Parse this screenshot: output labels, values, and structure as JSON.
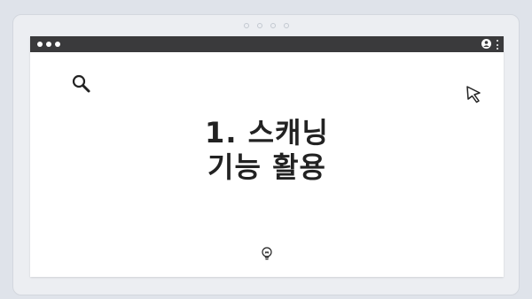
{
  "pager": {
    "dots": 4
  },
  "window": {
    "titlebar_color": "#3a3a3c",
    "icons": [
      "traffic-lights",
      "account-icon",
      "kebab-menu-icon"
    ]
  },
  "slide": {
    "headline_line1": "1. 스캐닝",
    "headline_line2": "기능 활용",
    "icons": [
      "search-icon",
      "cursor-icon",
      "lightbulb-icon"
    ]
  },
  "colors": {
    "background": "#dfe3ea",
    "text": "#222222",
    "titlebar": "#3a3a3c"
  }
}
